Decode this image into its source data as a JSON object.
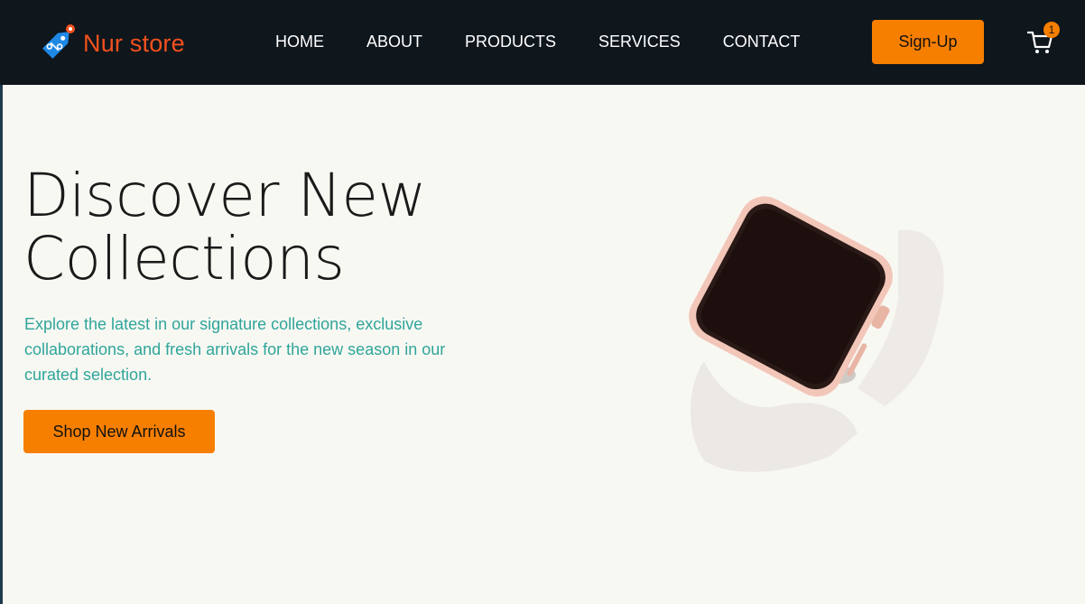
{
  "header": {
    "logo_text": "Nur store",
    "nav": [
      "HOME",
      "ABOUT",
      "PRODUCTS",
      "SERVICES",
      "CONTACT"
    ],
    "signup_label": "Sign-Up",
    "cart_count": "1"
  },
  "hero": {
    "title_line1": "Discover New",
    "title_line2": "Collections",
    "description": "Explore the latest in our signature collections, exclusive collaborations, and fresh arrivals for the new season in our curated selection.",
    "cta_label": "Shop New Arrivals",
    "product_image": "smartwatch-image"
  },
  "colors": {
    "header_bg": "#0f161c",
    "brand": "#f4511e",
    "accent": "#f77f00",
    "text_teal": "#2fa59a",
    "page_bg": "#f8f8f3"
  }
}
